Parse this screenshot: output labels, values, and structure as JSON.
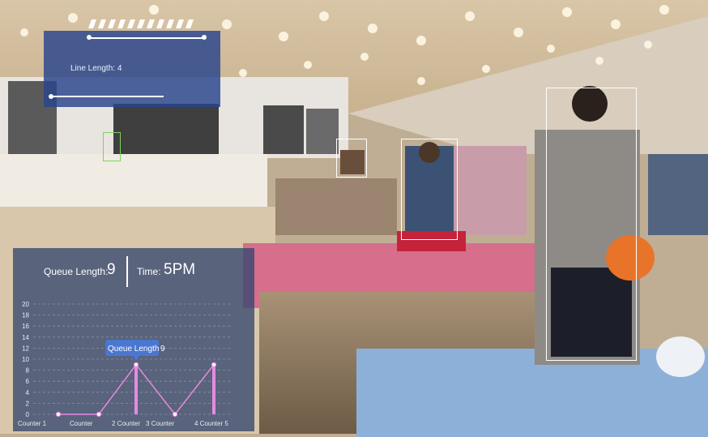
{
  "line_panel": {
    "label": "Line Length",
    "value": "4"
  },
  "queue_panel": {
    "queue_length_label": "Queue Length",
    "queue_length_value": "9",
    "time_label": "Time",
    "time_value": "5PM",
    "tooltip_label": "Queue Length",
    "tooltip_value": "9"
  },
  "chart_data": {
    "type": "line",
    "categories": [
      "Counter 1",
      "Counter 2",
      "Counter 3",
      "Counter 4",
      "Counter 5"
    ],
    "values": [
      0,
      0,
      9,
      0,
      9
    ],
    "ylim": [
      0,
      20
    ],
    "yticks": [
      0,
      2,
      4,
      6,
      8,
      10,
      12,
      14,
      16,
      18,
      20
    ],
    "xlabels": [
      "Counter 1",
      "Counter",
      "2 Counter",
      "3 Counter",
      "4 Counter 5"
    ],
    "grid": true,
    "colors": {
      "line": "#e58be0",
      "bar": "#e58be0",
      "tooltip": "#4a77cf"
    }
  },
  "colors": {
    "panel_blue": "#284a8c",
    "box": "#ffffff",
    "box_green": "#7cd45a"
  }
}
